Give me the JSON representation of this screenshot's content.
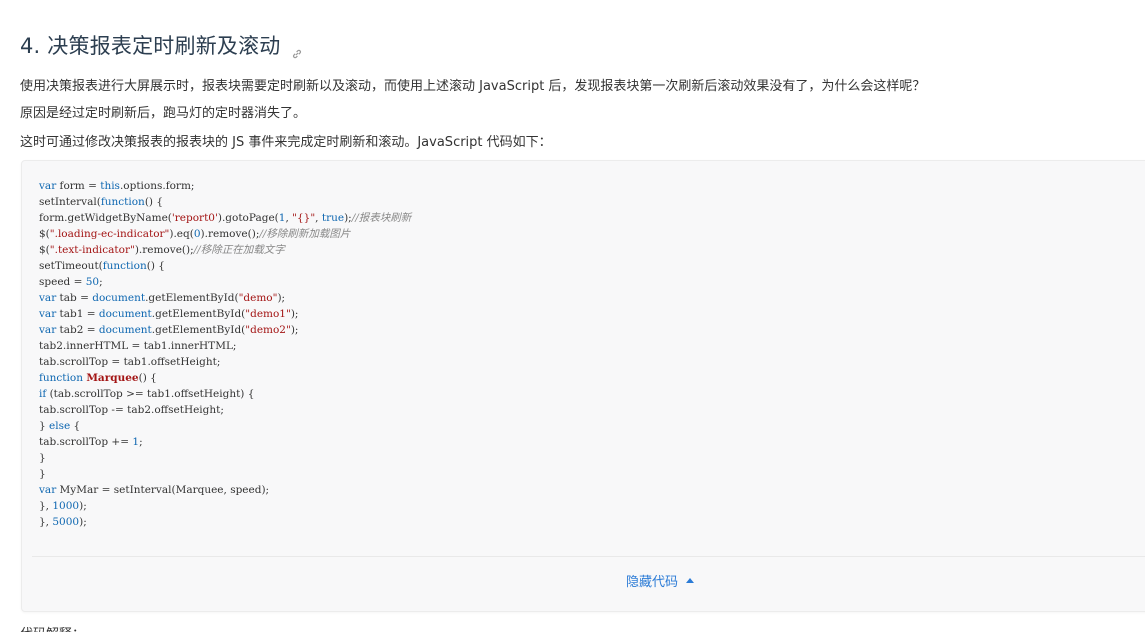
{
  "section": {
    "heading": "4. 决策报表定时刷新及滚动",
    "anchor_icon": "link-icon",
    "paragraphs": [
      "使用决策报表进行大屏展示时，报表块需要定时刷新以及滚动，而使用上述滚动 JavaScript 后，发现报表块第一次刷新后滚动效果没有了，为什么会这样呢？",
      "原因是经过定时刷新后，跑马灯的定时器消失了。",
      "这时可通过修改决策报表的报表块的 JS 事件来完成定时刷新和滚动。JavaScript 代码如下："
    ]
  },
  "code": {
    "lines": [
      "var form = this.options.form;",
      "setInterval(function() {",
      "form.getWidgetByName('report0').gotoPage(1, \"{}\", true);//报表块刷新",
      "$(\".loading-ec-indicator\").eq(0).remove();//移除刷新加载图片",
      "$(\".text-indicator\").remove();//移除正在加载文字",
      "setTimeout(function() {",
      "speed = 50;",
      "var tab = document.getElementById(\"demo\");",
      "var tab1 = document.getElementById(\"demo1\");",
      "var tab2 = document.getElementById(\"demo2\");",
      "tab2.innerHTML = tab1.innerHTML;",
      "tab.scrollTop = tab1.offsetHeight;",
      "function Marquee() {",
      "if (tab.scrollTop >= tab1.offsetHeight) {",
      "tab.scrollTop -= tab2.offsetHeight;",
      "} else {",
      "tab.scrollTop += 1;",
      "}",
      "}",
      "var MyMar = setInterval(Marquee, speed);",
      "}, 1000);",
      "}, 5000);"
    ],
    "toggle_label": "隐藏代码",
    "toggle_icon": "caret-up-icon"
  },
  "next_text": "代码解释："
}
